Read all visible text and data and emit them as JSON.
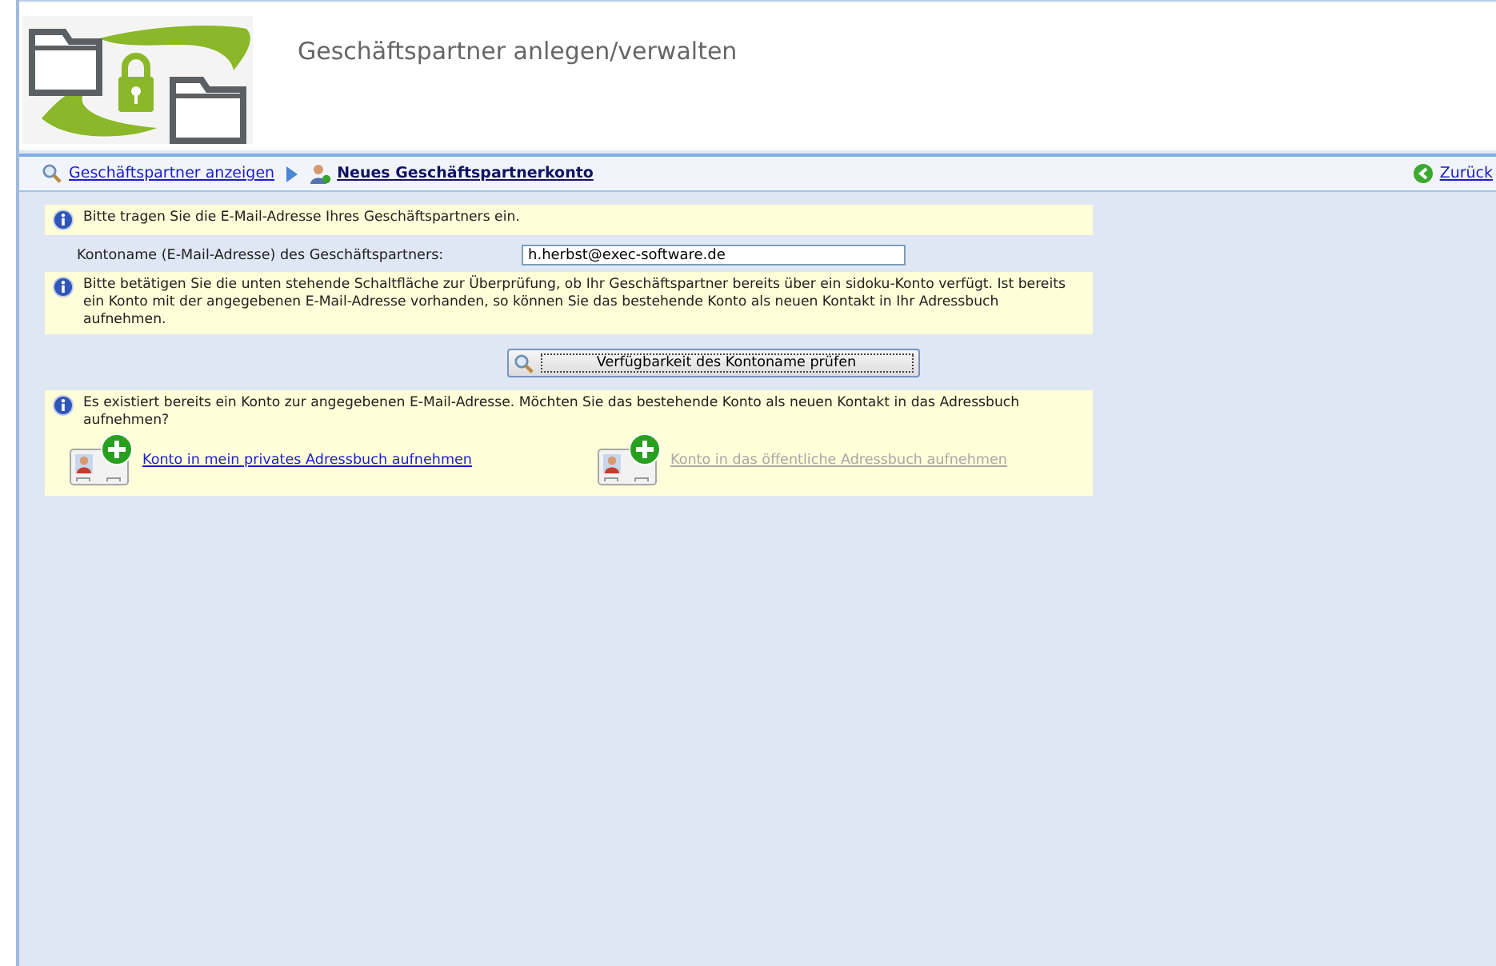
{
  "header": {
    "title": "Geschäftspartner anlegen/verwalten"
  },
  "breadcrumb": {
    "items": [
      {
        "label": "Geschäftspartner anzeigen",
        "current": false
      },
      {
        "label": "Neues Geschäftspartnerkonto",
        "current": true
      }
    ],
    "back": "Zurück"
  },
  "intro": "Bitte tragen Sie die E-Mail-Adresse Ihres Geschäftspartners ein.",
  "account_field": {
    "label": "Kontoname (E-Mail-Adresse) des Geschäftspartners:",
    "value": "h.herbst@exec-software.de"
  },
  "check_hint": "Bitte betätigen Sie die unten stehende Schaltfläche zur Überprüfung, ob Ihr Geschäftspartner bereits über ein sidoku-Konto verfügt. Ist bereits ein Konto mit der angegebenen E-Mail-Adresse vorhanden, so können Sie das bestehende Konto als neuen Kontakt in Ihr Adressbuch aufnehmen.",
  "check_button": "Verfügbarkeit des Kontoname prüfen",
  "result": {
    "message": "Es existiert bereits ein Konto zur angegebenen E-Mail-Adresse. Möchten Sie das bestehende Konto als neuen Kontakt in das Adressbuch aufnehmen?",
    "actions": [
      {
        "label": "Konto in mein privates Adressbuch aufnehmen",
        "disabled": false
      },
      {
        "label": "Konto in das öffentliche Adressbuch aufnehmen",
        "disabled": true
      }
    ]
  }
}
